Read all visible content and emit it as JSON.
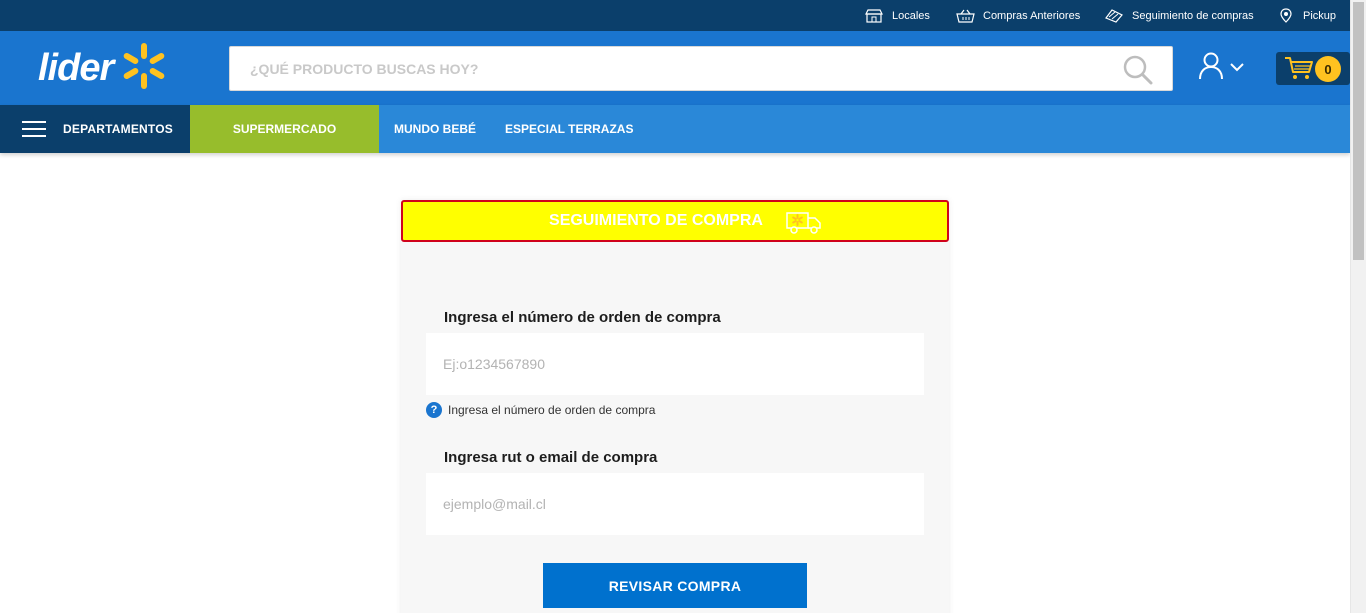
{
  "topbar": {
    "links": [
      {
        "label": "Locales",
        "icon": "store-icon"
      },
      {
        "label": "Compras Anteriores",
        "icon": "basket-icon"
      },
      {
        "label": "Seguimiento de compras",
        "icon": "tracking-icon"
      },
      {
        "label": "Pickup",
        "icon": "location-pin-icon"
      }
    ]
  },
  "header": {
    "logo_text": "lider",
    "search_placeholder": "¿QUÉ PRODUCTO BUSCAS HOY?",
    "cart_count": "0"
  },
  "nav": {
    "departments_label": "DEPARTAMENTOS",
    "items": [
      "SUPERMERCADO",
      "MUNDO BEBÉ",
      "ESPECIAL TERRAZAS"
    ]
  },
  "tracking": {
    "title": "SEGUIMIENTO DE COMPRA",
    "order_label": "Ingresa el número de orden de compra",
    "order_placeholder": "Ej:o1234567890",
    "order_hint": "Ingresa el número de orden de compra",
    "hint_icon_glyph": "?",
    "rut_label": "Ingresa rut o email de compra",
    "rut_placeholder": "ejemplo@mail.cl",
    "submit_label": "REVISAR COMPRA"
  },
  "colors": {
    "topbar": "#0b3f6b",
    "header": "#1a75cf",
    "navbar": "#2a88d8",
    "supermercado": "#97bd2c",
    "spark": "#ffc220",
    "tracking_header_bg": "#ffff00",
    "tracking_header_border": "#d0021b",
    "button": "#0071ce"
  }
}
